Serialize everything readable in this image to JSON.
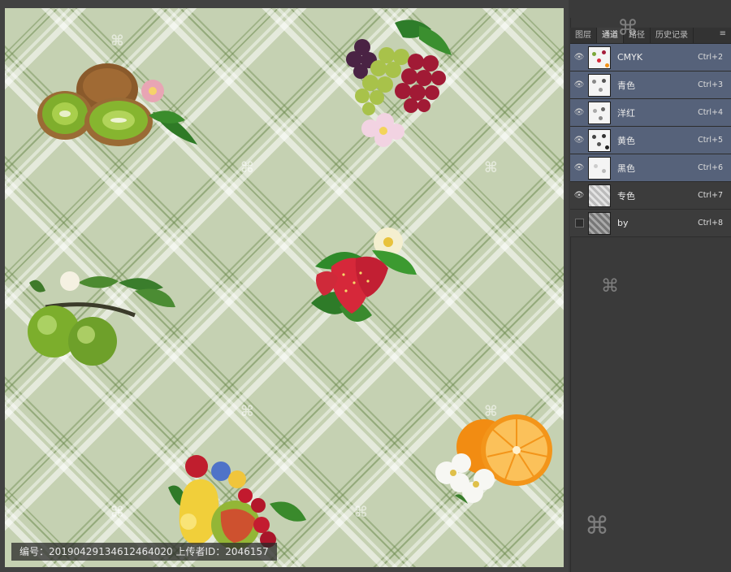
{
  "panel": {
    "tabs": [
      {
        "label": "图层"
      },
      {
        "label": "通道"
      },
      {
        "label": "路径"
      },
      {
        "label": "历史记录"
      }
    ],
    "active_tab": 1,
    "collapse_glyph": "◂◂",
    "menu_glyph": "≡",
    "channels": [
      {
        "name": "CMYK",
        "shortcut": "Ctrl+2",
        "visible": true,
        "selected": true
      },
      {
        "name": "青色",
        "shortcut": "Ctrl+3",
        "visible": true,
        "selected": true
      },
      {
        "name": "洋红",
        "shortcut": "Ctrl+4",
        "visible": true,
        "selected": true
      },
      {
        "name": "黄色",
        "shortcut": "Ctrl+5",
        "visible": true,
        "selected": true
      },
      {
        "name": "黑色",
        "shortcut": "Ctrl+6",
        "visible": true,
        "selected": true
      },
      {
        "name": "专色",
        "shortcut": "Ctrl+7",
        "visible": true,
        "selected": false
      },
      {
        "name": "by",
        "shortcut": "Ctrl+8",
        "visible": false,
        "selected": false
      }
    ]
  },
  "canvas": {
    "background": "#c5d1b2",
    "caption": "编号：20190429134612464020 上传者ID：2046157",
    "fruits": [
      {
        "name": "kiwi"
      },
      {
        "name": "grapes"
      },
      {
        "name": "strawberry"
      },
      {
        "name": "green-apples"
      },
      {
        "name": "fruit-bunch"
      },
      {
        "name": "orange"
      }
    ]
  },
  "colors": {
    "selected_row": "#56627a",
    "panel_bg": "#3a3a3a",
    "canvas_bg": "#c5d1b2"
  }
}
